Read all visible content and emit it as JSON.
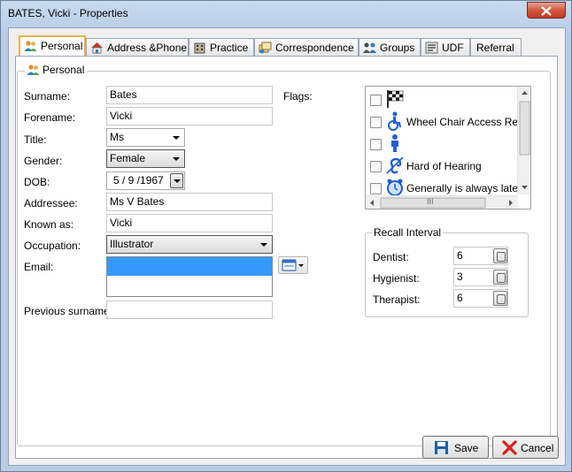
{
  "window": {
    "title": "BATES, Vicki - Properties"
  },
  "tabs": [
    {
      "label": "Personal",
      "active": true,
      "icon": "people-icon"
    },
    {
      "label": "Address &Phone",
      "icon": "house-icon"
    },
    {
      "label": "Practice",
      "icon": "building-icon"
    },
    {
      "label": "Correspondence",
      "icon": "letters-icon"
    },
    {
      "label": "Groups",
      "icon": "group-icon"
    },
    {
      "label": "UDF",
      "icon": "udf-icon"
    },
    {
      "label": "Referral"
    }
  ],
  "personal": {
    "group_label": "Personal",
    "surname": {
      "label": "Surname:",
      "value": "Bates"
    },
    "forename": {
      "label": "Forename:",
      "value": "Vicki"
    },
    "title": {
      "label": "Title:",
      "value": "Ms"
    },
    "gender": {
      "label": "Gender:",
      "value": "Female"
    },
    "dob": {
      "label": "DOB:",
      "value": "5 / 9 /1967"
    },
    "addressee": {
      "label": "Addressee:",
      "value": "Ms V Bates"
    },
    "known_as": {
      "label": "Known as:",
      "value": "Vicki"
    },
    "occupation": {
      "label": "Occupation:",
      "value": "Illustrator"
    },
    "email": {
      "label": "Email:",
      "value": ""
    },
    "previous_surname": {
      "label": "Previous surname:",
      "value": ""
    }
  },
  "flags": {
    "label": "Flags:",
    "items": [
      {
        "text": "",
        "icon": "checkered-flag-icon",
        "checked": false
      },
      {
        "text": "Wheel Chair Access Requ",
        "icon": "wheelchair-icon",
        "checked": false
      },
      {
        "text": "",
        "icon": "person-icon",
        "checked": false
      },
      {
        "text": "Hard of Hearing",
        "icon": "ear-icon",
        "checked": false
      },
      {
        "text": "Generally is always late",
        "icon": "clock-icon",
        "checked": false
      }
    ],
    "scroll_thumb": "III"
  },
  "recall": {
    "title": "Recall Interval",
    "rows": [
      {
        "label": "Dentist:",
        "value": "6"
      },
      {
        "label": "Hygienist:",
        "value": "3"
      },
      {
        "label": "Therapist:",
        "value": "6"
      }
    ]
  },
  "buttons": {
    "save": "Save",
    "cancel": "Cancel"
  },
  "colors": {
    "active_tab_border": "#e9b44a",
    "selection": "#3399ff",
    "close": "#c23a22"
  }
}
